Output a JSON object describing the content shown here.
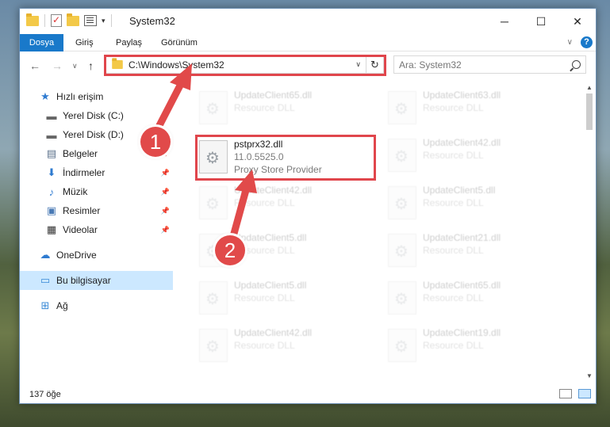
{
  "window": {
    "title": "System32",
    "caption_minimize": "─",
    "caption_maximize": "☐",
    "caption_close": "✕"
  },
  "ribbon": {
    "tabs": [
      "Dosya",
      "Giriş",
      "Paylaş",
      "Görünüm"
    ],
    "expand_chevron": "∨",
    "help_label": "?"
  },
  "nav": {
    "back": "←",
    "forward": "→",
    "recent": "∨",
    "up": "↑",
    "address": "C:\\Windows\\System32",
    "address_dropdown": "∨",
    "refresh": "↻",
    "search_placeholder": "Ara: System32"
  },
  "sidebar": {
    "items": [
      {
        "label": "Hızlı erişim",
        "icon": "star-icon",
        "glyph": "★",
        "color": "#2f7bd0"
      },
      {
        "label": "Yerel Disk (C:)",
        "icon": "disk-icon",
        "glyph": "▬",
        "color": "#666666"
      },
      {
        "label": "Yerel Disk (D:)",
        "icon": "disk-icon",
        "glyph": "▬",
        "color": "#666666"
      },
      {
        "label": "Belgeler",
        "icon": "documents-icon",
        "glyph": "▤",
        "color": "#5a6f8a"
      },
      {
        "label": "İndirmeler",
        "icon": "download-icon",
        "glyph": "⬇",
        "color": "#2f7bd0"
      },
      {
        "label": "Müzik",
        "icon": "music-icon",
        "glyph": "♪",
        "color": "#2f7bd0"
      },
      {
        "label": "Resimler",
        "icon": "pictures-icon",
        "glyph": "▣",
        "color": "#4a7ab5"
      },
      {
        "label": "Videolar",
        "icon": "video-icon",
        "glyph": "▦",
        "color": "#333333"
      },
      {
        "label": "OneDrive",
        "icon": "cloud-icon",
        "glyph": "☁",
        "color": "#2f7bd0"
      },
      {
        "label": "Bu bilgisayar",
        "icon": "computer-icon",
        "glyph": "▭",
        "color": "#3a8ad6"
      },
      {
        "label": "Ağ",
        "icon": "network-icon",
        "glyph": "⊞",
        "color": "#3a8ad6"
      }
    ],
    "pin_glyph": "📌"
  },
  "files": {
    "highlighted": {
      "name": "pstprx32.dll",
      "version": "11.0.5525.0",
      "description": "Proxy Store Provider"
    },
    "left_column": [
      {
        "name": "UpdateClient65.dll",
        "type": "Resource DLL"
      },
      {
        "name": "UpdateClient42.dll",
        "type": "Resource DLL"
      },
      {
        "name": "UpdateClient5.dll",
        "type": "Resource DLL"
      },
      {
        "name": "UpdateClient5.dll",
        "type": "Resource DLL"
      },
      {
        "name": "UpdateClient42.dll",
        "type": "Resource DLL"
      }
    ],
    "right_column": [
      {
        "name": "UpdateClient63.dll",
        "type": "Resource DLL"
      },
      {
        "name": "UpdateClient42.dll",
        "type": "Resource DLL"
      },
      {
        "name": "UpdateClient5.dll",
        "type": "Resource DLL"
      },
      {
        "name": "UpdateClient21.dll",
        "type": "Resource DLL"
      },
      {
        "name": "UpdateClient65.dll",
        "type": "Resource DLL"
      },
      {
        "name": "UpdateClient19.dll",
        "type": "Resource DLL"
      }
    ]
  },
  "status": {
    "item_count": "137 öğe"
  },
  "callouts": [
    "1",
    "2"
  ],
  "colors": {
    "accent": "#1979ca",
    "highlight": "#e0464c",
    "selection": "#cce8ff"
  }
}
